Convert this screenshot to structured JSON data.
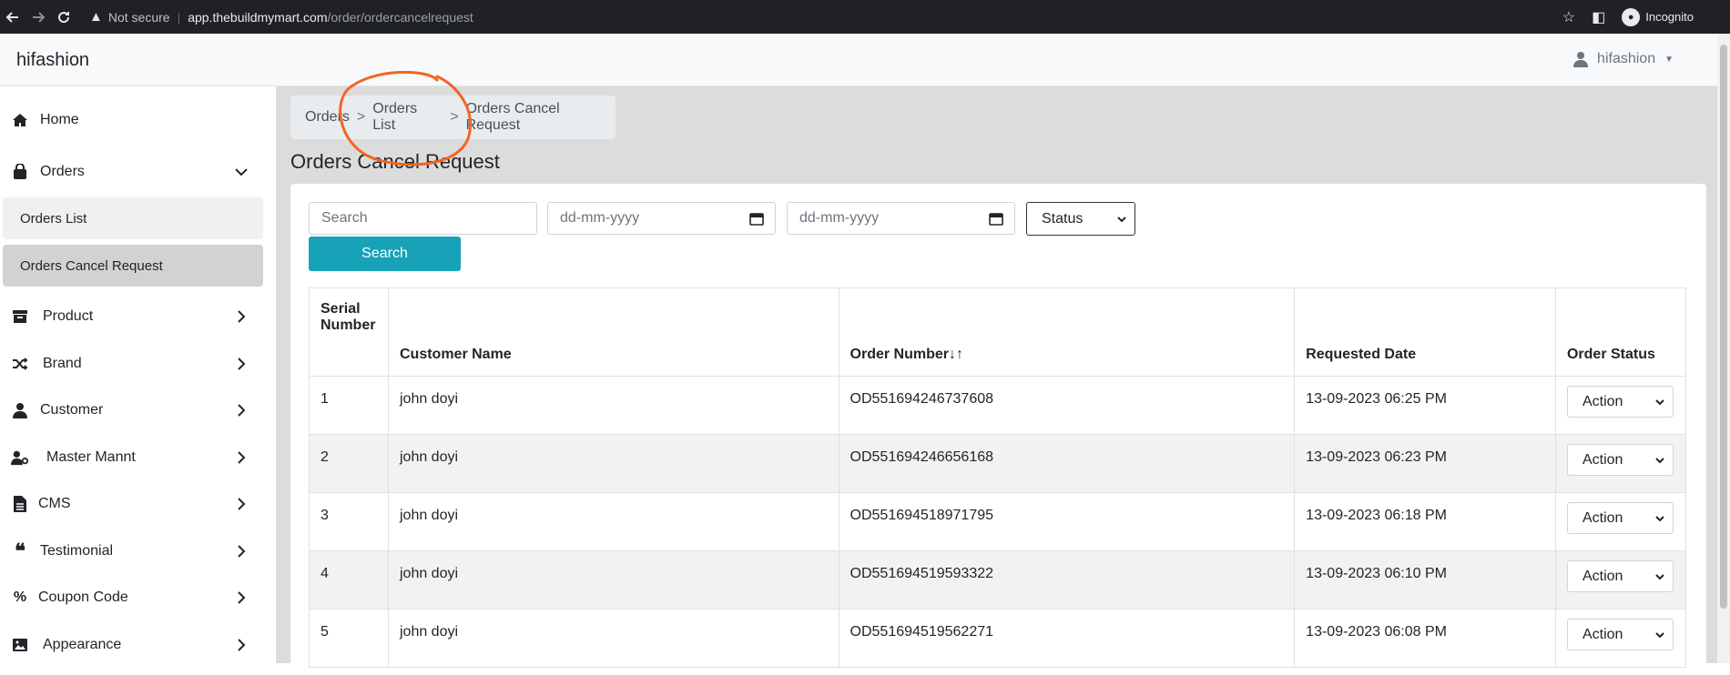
{
  "browser": {
    "security_label": "Not secure",
    "url_host": "app.thebuildmymart.com",
    "url_path": "/order/ordercancelrequest",
    "incognito_label": "Incognito"
  },
  "app": {
    "brand": "hifashion",
    "user_name": "hifashion"
  },
  "sidebar": {
    "home": "Home",
    "orders": "Orders",
    "orders_list": "Orders List",
    "orders_cancel_request": "Orders Cancel Request",
    "product": "Product",
    "brand": "Brand",
    "customer": "Customer",
    "master_mannt": "Master Mannt",
    "cms": "CMS",
    "testimonial": "Testimonial",
    "coupon_code": "Coupon Code",
    "appearance": "Appearance"
  },
  "breadcrumb": {
    "items": [
      "Orders",
      "Orders List",
      "Orders Cancel Request"
    ],
    "separator": ">"
  },
  "page_title": "Orders Cancel Request",
  "filters": {
    "search_placeholder": "Search",
    "date_from_placeholder": "dd-mm-yyyy",
    "date_to_placeholder": "dd-mm-yyyy",
    "status_label": "Status",
    "search_button": "Search"
  },
  "table": {
    "headers": {
      "serial_line1": "Serial",
      "serial_line2": "Number",
      "customer": "Customer Name",
      "order_number": "Order Number",
      "sort_icon": "↓↑",
      "requested_date": "Requested Date",
      "order_status": "Order Status"
    },
    "action_label": "Action",
    "rows": [
      {
        "serial": "1",
        "customer": "john doyi",
        "order_number": "OD551694246737608",
        "requested_date": "13-09-2023 06:25 PM"
      },
      {
        "serial": "2",
        "customer": "john doyi",
        "order_number": "OD551694246656168",
        "requested_date": "13-09-2023 06:23 PM"
      },
      {
        "serial": "3",
        "customer": "john doyi",
        "order_number": "OD551694518971795",
        "requested_date": "13-09-2023 06:18 PM"
      },
      {
        "serial": "4",
        "customer": "john doyi",
        "order_number": "OD551694519593322",
        "requested_date": "13-09-2023 06:10 PM"
      },
      {
        "serial": "5",
        "customer": "john doyi",
        "order_number": "OD551694519562271",
        "requested_date": "13-09-2023 06:08 PM"
      }
    ]
  },
  "colors": {
    "primary_button": "#17a2b8",
    "annotation": "#f26522",
    "main_background": "#dcdcdc",
    "active_nav": "#d2d2d2"
  }
}
